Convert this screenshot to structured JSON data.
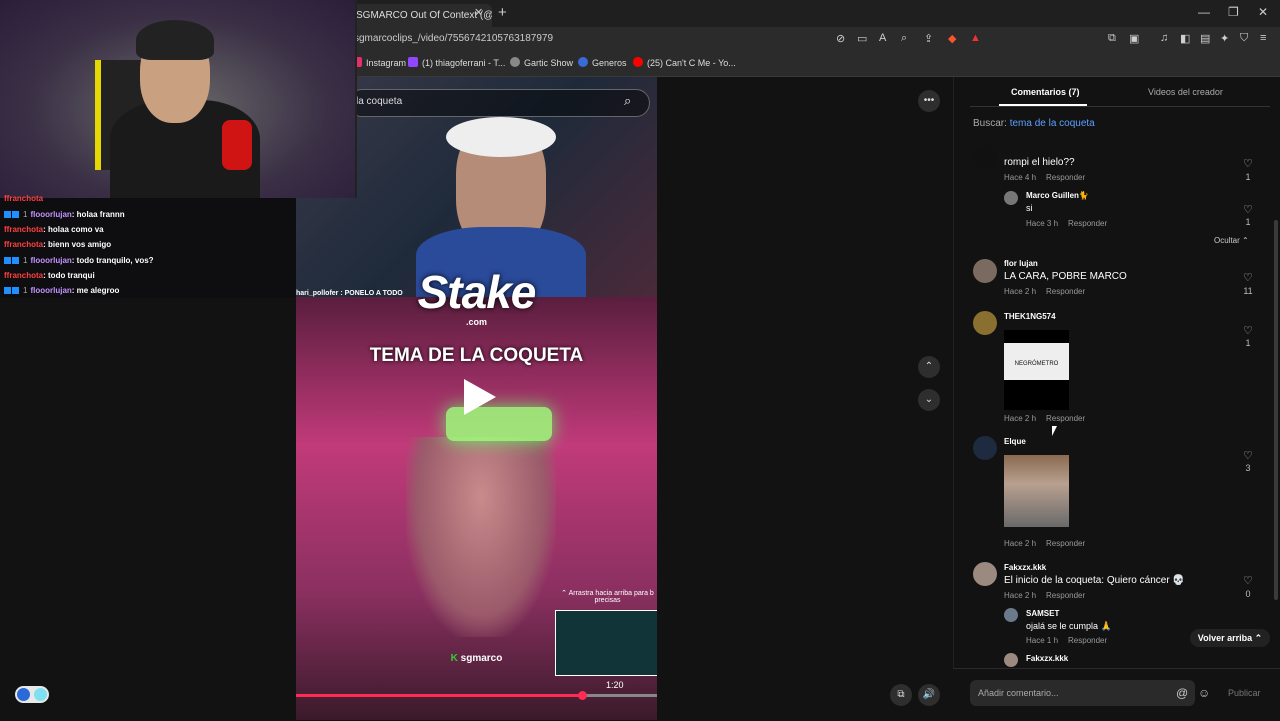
{
  "browser": {
    "tab_title": "SGMARCO Out Of Context (@sg",
    "tab_close": "✕",
    "new_tab": "+",
    "url": "sgmarcoclips_/video/7556742105763187979",
    "window_controls": [
      "—",
      "❐",
      "✕"
    ],
    "bookmarks": [
      {
        "label": "Instagram",
        "color": "#e1306c"
      },
      {
        "label": "(1) thiagoferrani - T...",
        "color": "#9146ff"
      },
      {
        "label": "Gartic Show",
        "color": "#888888"
      },
      {
        "label": "Generos",
        "color": "#3a6ad8"
      },
      {
        "label": "(25) Can't C Me - Yo...",
        "color": "#ff0000"
      }
    ]
  },
  "video": {
    "search_text": "la coqueta",
    "brand": "Stake",
    "brand_sub": ".com",
    "banner": "TEMA DE LA COQUETA",
    "overlay_small": "hari_pollofer : PONELO A TODO",
    "swipe_hint": "⌃ Arrastra hacia arriba para b precisas",
    "creator_badge": "K",
    "creator": "sgmarco",
    "time": "1:20",
    "progress": 0.795
  },
  "controls": {
    "more": "•••",
    "up": "⌃",
    "down": "⌄"
  },
  "chat": [
    {
      "user": "ffranchota",
      "msg": "",
      "style": "u2",
      "badges": false,
      "partial": true
    },
    {
      "user": "flooorlujan",
      "msg": ": holaa frannn",
      "style": "u1",
      "badges": true
    },
    {
      "user": "ffranchota",
      "msg": ": holaa como va",
      "style": "u2",
      "badges": false
    },
    {
      "user": "ffranchota",
      "msg": ": bienn vos amigo",
      "style": "u2",
      "badges": false
    },
    {
      "user": "flooorlujan",
      "msg": ": todo tranquilo, vos?",
      "style": "u1",
      "badges": true
    },
    {
      "user": "ffranchota",
      "msg": ": todo tranqui",
      "style": "u2",
      "badges": false
    },
    {
      "user": "flooorlujan",
      "msg": ": me alegroo",
      "style": "u1",
      "badges": true
    }
  ],
  "panel": {
    "tab_comments": "Comentarios (7)",
    "tab_creator": "Videos del creador",
    "buscar_label": "Buscar:",
    "buscar_query": "tema de la coqueta",
    "hide": "Ocultar ⌃",
    "back_top": "Volver arriba ⌃",
    "input_placeholder": "Añadir comentario...",
    "at": "@",
    "emoji": "☺",
    "publish": "Publicar",
    "reply": "Responder"
  },
  "comments": [
    {
      "name": "",
      "text": "rompi el hielo??",
      "time": "Hace 4 h",
      "likes": "1"
    },
    {
      "name": "Marco Guillen🐈",
      "text": "si",
      "time": "Hace 3 h",
      "likes": "1",
      "reply": true
    },
    {
      "name": "flor lujan",
      "text": "LA CARA, POBRE MARCO",
      "time": "Hace 2 h",
      "likes": "11"
    },
    {
      "name": "THEK1NG574",
      "text": "",
      "time": "Hace 2 h",
      "likes": "1",
      "image_caption": "NEGRÓMETRO"
    },
    {
      "name": "Elque",
      "text": "",
      "time": "Hace 2 h",
      "likes": "3"
    },
    {
      "name": "Fakxzx.kkk",
      "text": "El inicio de la coqueta: Quiero cáncer 💀",
      "time": "Hace 2 h",
      "likes": "0"
    },
    {
      "name": "SAMSET",
      "text": "ojalá se le cumpla 🙏",
      "time": "Hace 1 h",
      "likes": "",
      "reply": true
    },
    {
      "name": "Fakxzx.kkk",
      "text": "",
      "time": "",
      "likes": "",
      "reply": true
    }
  ]
}
